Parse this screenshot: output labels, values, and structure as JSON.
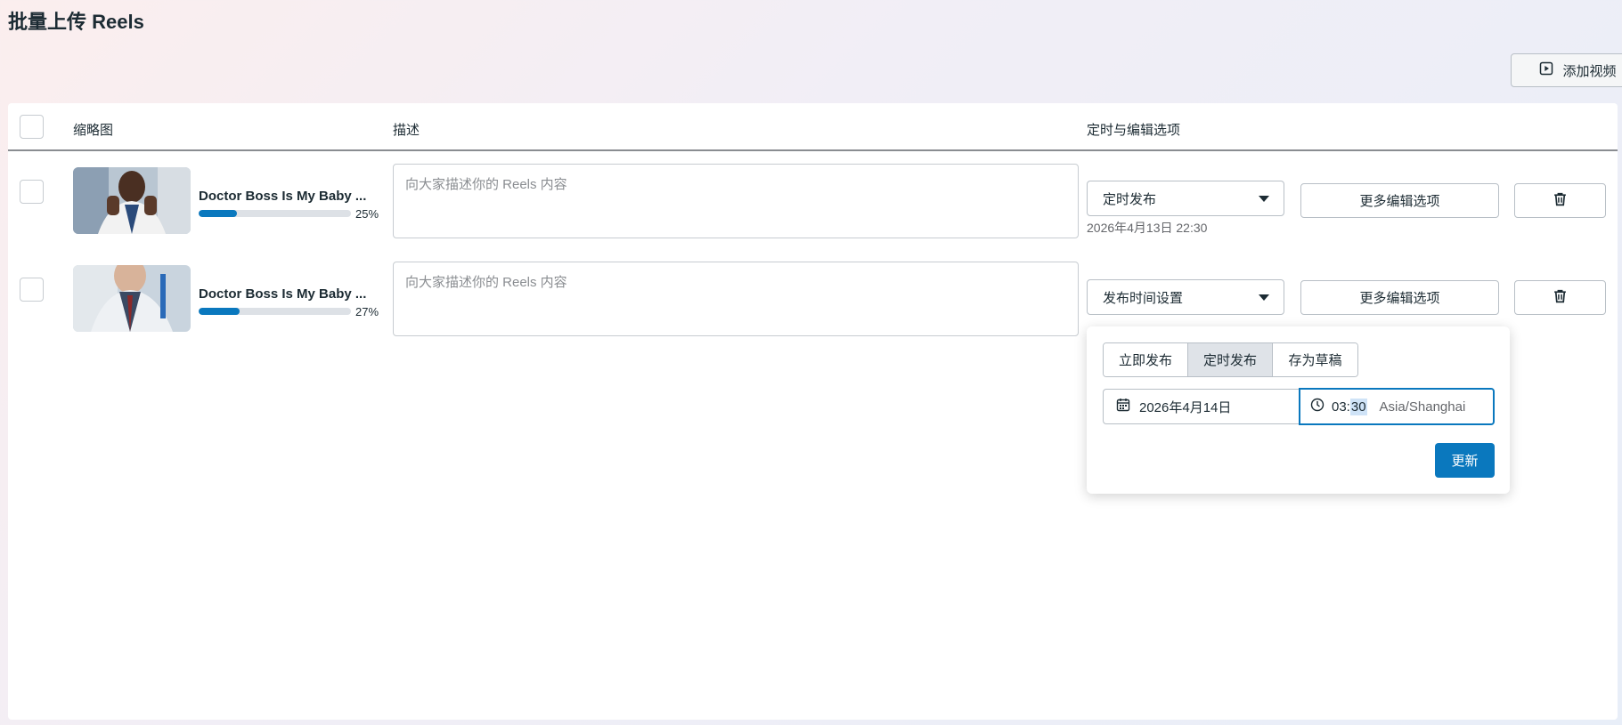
{
  "page": {
    "title": "批量上传 Reels",
    "add_video_label": "添加视频"
  },
  "table": {
    "headers": {
      "thumbnail": "缩略图",
      "description": "描述",
      "schedule": "定时与编辑选项"
    },
    "rows": [
      {
        "title": "Doctor Boss Is My Baby ...",
        "progress": 25,
        "progress_label": "25%",
        "description_placeholder": "向大家描述你的 Reels 内容",
        "schedule_select": "定时发布",
        "scheduled_time": "2026年4月13日 22:30",
        "more_edit_label": "更多编辑选项"
      },
      {
        "title": "Doctor Boss Is My Baby ...",
        "progress": 27,
        "progress_label": "27%",
        "description_placeholder": "向大家描述你的 Reels 内容",
        "schedule_select": "发布时间设置",
        "scheduled_time": "",
        "more_edit_label": "更多编辑选项"
      }
    ]
  },
  "popover": {
    "options": [
      "立即发布",
      "定时发布",
      "存为草稿"
    ],
    "active_option": "定时发布",
    "date": "2026年4月14日",
    "time_hour": "03:",
    "time_minute": "30",
    "timezone": "Asia/Shanghai",
    "update_label": "更新"
  },
  "colors": {
    "accent": "#0a78be",
    "text": "#1c2b33",
    "muted": "#65676b"
  }
}
